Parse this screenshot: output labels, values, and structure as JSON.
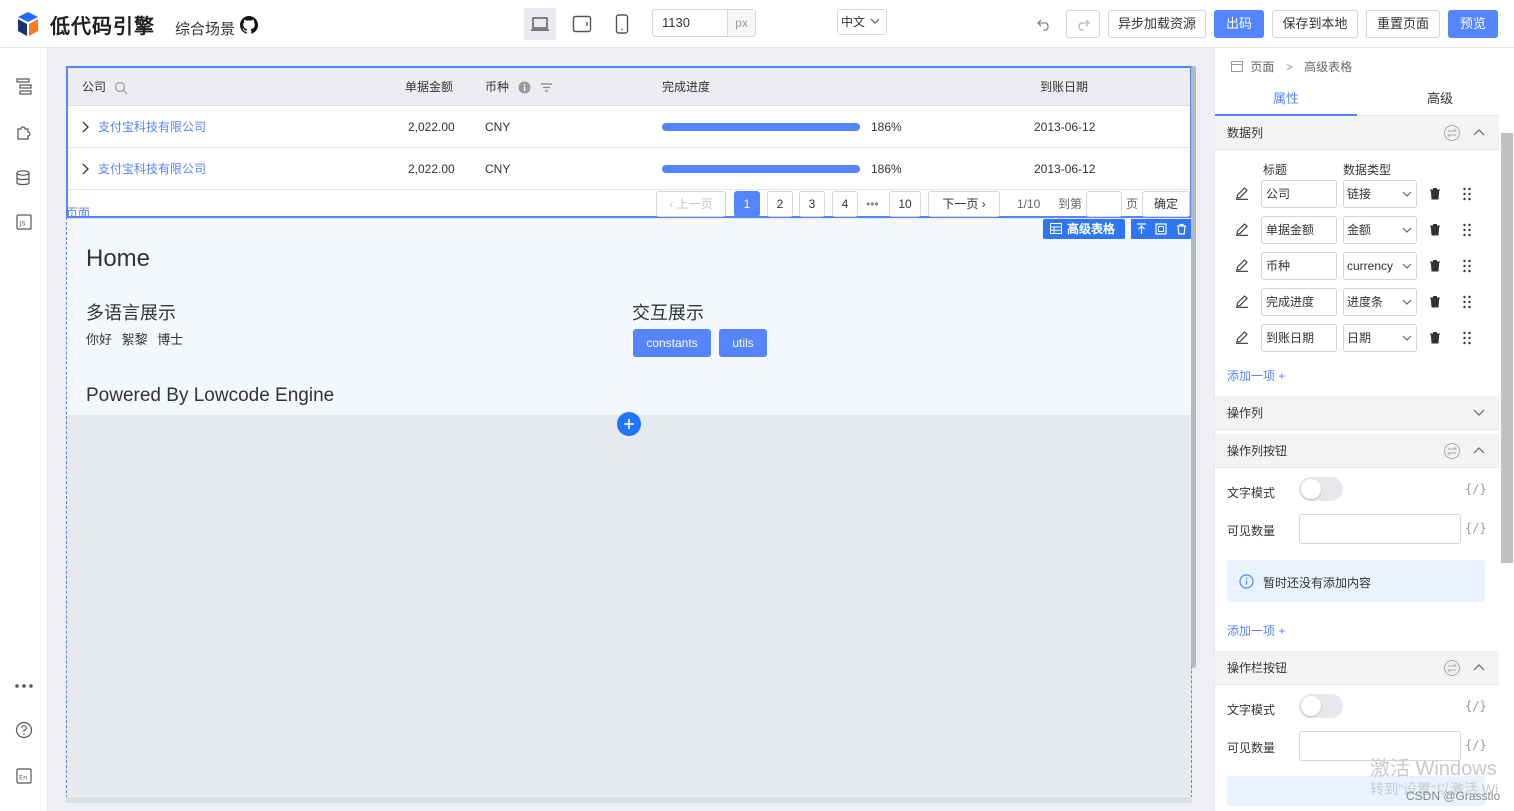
{
  "topbar": {
    "logo_text": "低代码引擎",
    "scene": "综合场景",
    "canvas_width": "1130",
    "canvas_unit": "px",
    "locale": "中文",
    "buttons": {
      "async_load": "异步加载资源",
      "export": "出码",
      "save_local": "保存到本地",
      "reset": "重置页面",
      "preview": "预览"
    }
  },
  "table": {
    "headers": {
      "company": "公司",
      "amount": "单据金额",
      "currency": "币种",
      "progress": "完成进度",
      "date": "到账日期"
    },
    "rows": [
      {
        "company": "支付宝科技有限公司",
        "amount": "2,022.00",
        "currency": "CNY",
        "progress_pct": 186,
        "progress_text": "186%",
        "date": "2013-06-12"
      },
      {
        "company": "支付宝科技有限公司",
        "amount": "2,022.00",
        "currency": "CNY",
        "progress_pct": 186,
        "progress_text": "186%",
        "date": "2013-06-12"
      }
    ],
    "pager": {
      "prev": "上一页",
      "pages": [
        "1",
        "2",
        "3",
        "4"
      ],
      "ellipsis": "•••",
      "last": "10",
      "next": "下一页",
      "summary": "1/10",
      "goto_prefix": "到第",
      "goto_suffix": "页",
      "confirm": "确定"
    },
    "page_label": "页面",
    "selection_tag": "高级表格"
  },
  "page": {
    "title": "Home",
    "i18n_title": "多语言展示",
    "i18n_text": "你好 絮黎 博士",
    "interact_title": "交互展示",
    "btn_constants": "constants",
    "btn_utils": "utils",
    "powered": "Powered By Lowcode Engine"
  },
  "panel": {
    "crumb_page": "页面",
    "crumb_current": "高级表格",
    "tab_props": "属性",
    "tab_advanced": "高级",
    "group_data_columns": "数据列",
    "col_header_title": "标题",
    "col_header_type": "数据类型",
    "columns": [
      {
        "title": "公司",
        "type": "链接"
      },
      {
        "title": "单据金额",
        "type": "金额"
      },
      {
        "title": "币种",
        "type": "currency"
      },
      {
        "title": "完成进度",
        "type": "进度条"
      },
      {
        "title": "到账日期",
        "type": "日期"
      }
    ],
    "add_item": "添加一项 +",
    "group_action_col": "操作列",
    "group_action_buttons": "操作列按钮",
    "text_mode": "文字模式",
    "visible_count": "可见数量",
    "code_tag": "{/}",
    "empty_notice": "暂时还没有添加内容",
    "group_toolbar_buttons": "操作栏按钮"
  },
  "watermark": {
    "line1": "激活 Windows",
    "line2": "转到\"设置\"以激活 Wi",
    "csdn": "CSDN @Grasstio"
  },
  "colors": {
    "accent": "#5584ff",
    "selection": "#2e76f5"
  }
}
